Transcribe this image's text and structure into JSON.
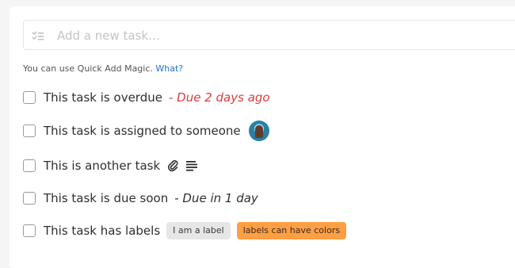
{
  "add_task": {
    "placeholder": "Add a new task…",
    "icon": "list-check-icon"
  },
  "hint": {
    "text": "You can use Quick Add Magic.",
    "link": "What?"
  },
  "tasks": [
    {
      "title": "This task is overdue",
      "due": "- Due 2 days ago",
      "due_color": "#e03b3b"
    },
    {
      "title": "This task is assigned to someone",
      "assignee_icon": "avatar"
    },
    {
      "title": "This is another task",
      "icons": [
        "paperclip-icon",
        "description-icon"
      ]
    },
    {
      "title": "This task is due soon",
      "due": "- Due in 1 day"
    },
    {
      "title": "This task has labels",
      "labels": [
        {
          "text": "I am a label",
          "color": "#e6e6e6"
        },
        {
          "text": "labels can have colors",
          "color": "#ff9f45"
        }
      ]
    }
  ]
}
